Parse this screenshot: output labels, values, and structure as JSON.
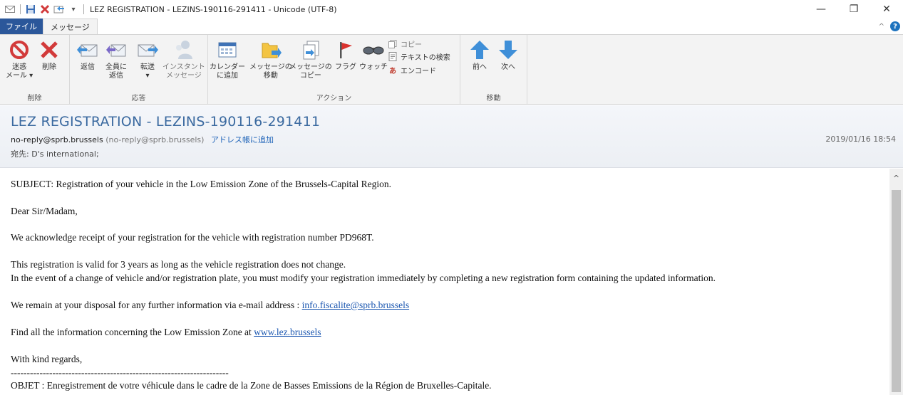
{
  "window": {
    "title": "LEZ REGISTRATION - LEZINS-190116-291411 - Unicode (UTF-8)",
    "minimize": "—",
    "restore": "❐",
    "close": "✕"
  },
  "tabs": {
    "file": "ファイル",
    "message": "メッセージ"
  },
  "ribbon": {
    "groups": {
      "delete": "削除",
      "respond": "応答",
      "actions": "アクション",
      "move": "移動"
    },
    "buttons": {
      "junk_line1": "迷惑",
      "junk_line2": "メール ▾",
      "delete": "削除",
      "reply": "返信",
      "reply_all_line1": "全員に",
      "reply_all_line2": "返信",
      "forward_line1": "転送",
      "forward_line2": "▾",
      "im_line1": "インスタント",
      "im_line2": "メッセージ",
      "calendar_line1": "カレンダー",
      "calendar_line2": "に追加",
      "move_msg_line1": "メッセージの",
      "move_msg_line2": "移動",
      "copy_msg_line1": "メッセージの",
      "copy_msg_line2": "コピー",
      "flag": "フラグ",
      "watch": "ウォッチ",
      "copy": "コピー",
      "find_text": "テキストの検索",
      "encode": "エンコード",
      "previous": "前へ",
      "next": "次へ"
    }
  },
  "header": {
    "subject": "LEZ REGISTRATION - LEZINS-190116-291411",
    "from_address": "no-reply@sprb.brussels",
    "from_paren": "(no-reply@sprb.brussels)",
    "add_to_address_book": "アドレス帳に追加",
    "date": "2019/01/16 18:54",
    "to_label": "宛先:",
    "to_value": "D's international;"
  },
  "body": {
    "line1": "SUBJECT: Registration of your vehicle in the Low Emission Zone of the Brussels-Capital Region.",
    "line2": "Dear Sir/Madam,",
    "line3": "We acknowledge receipt of your registration for the vehicle with registration number PD968T.",
    "line4": "This registration is valid for 3 years as long as the vehicle registration does not change.",
    "line5": "In the event of a change of vehicle and/or registration plate, you must modify your registration immediately by completing a new registration form containing the updated information.",
    "line6_prefix": "We remain at your disposal for any further information via e-mail address : ",
    "line6_link": "info.fiscalite@sprb.brussels",
    "line7_prefix": "Find all the information concerning the Low Emission Zone at ",
    "line7_link": "www.lez.brussels",
    "line8": "With kind regards,",
    "separator": "--------------------------------------------------------------------",
    "line9": "OBJET : Enregistrement de votre véhicule dans le cadre de la Zone de Basses Emissions de la Région de Bruxelles-Capitale."
  },
  "colors": {
    "accent": "#2b579a",
    "subject": "#3b6aa0",
    "link": "#1a56b0"
  }
}
